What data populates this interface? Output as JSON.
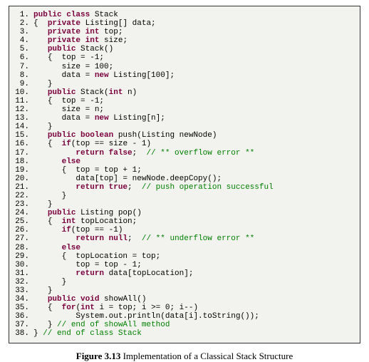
{
  "caption_bold": "Figure 3.13",
  "caption_rest": " Implementation of a Classical Stack Structure",
  "lines": [
    {
      "n": "1.",
      "indent": 0,
      "segs": [
        {
          "t": "public class",
          "c": "kw"
        },
        {
          "t": " Stack"
        }
      ]
    },
    {
      "n": "2.",
      "indent": 0,
      "segs": [
        {
          "t": "{  "
        },
        {
          "t": "private",
          "c": "kw"
        },
        {
          "t": " Listing[] data;"
        }
      ]
    },
    {
      "n": "3.",
      "indent": 1,
      "segs": [
        {
          "t": "private int",
          "c": "kw"
        },
        {
          "t": " top;"
        }
      ]
    },
    {
      "n": "4.",
      "indent": 1,
      "segs": [
        {
          "t": "private int",
          "c": "kw"
        },
        {
          "t": " size;"
        }
      ]
    },
    {
      "n": "5.",
      "indent": 1,
      "segs": [
        {
          "t": "public",
          "c": "kw"
        },
        {
          "t": " Stack()"
        }
      ]
    },
    {
      "n": "6.",
      "indent": 1,
      "segs": [
        {
          "t": "{  top = -1;"
        }
      ]
    },
    {
      "n": "7.",
      "indent": 2,
      "segs": [
        {
          "t": "size = 100;"
        }
      ]
    },
    {
      "n": "8.",
      "indent": 2,
      "segs": [
        {
          "t": "data = "
        },
        {
          "t": "new",
          "c": "kw"
        },
        {
          "t": " Listing[100];"
        }
      ]
    },
    {
      "n": "9.",
      "indent": 1,
      "segs": [
        {
          "t": "}"
        }
      ]
    },
    {
      "n": "10.",
      "indent": 1,
      "segs": [
        {
          "t": "public",
          "c": "kw"
        },
        {
          "t": " Stack("
        },
        {
          "t": "int",
          "c": "kw"
        },
        {
          "t": " n)"
        }
      ]
    },
    {
      "n": "11.",
      "indent": 1,
      "segs": [
        {
          "t": "{  top = -1;"
        }
      ]
    },
    {
      "n": "12.",
      "indent": 2,
      "segs": [
        {
          "t": "size = n;"
        }
      ]
    },
    {
      "n": "13.",
      "indent": 2,
      "segs": [
        {
          "t": "data = "
        },
        {
          "t": "new",
          "c": "kw"
        },
        {
          "t": " Listing[n];"
        }
      ]
    },
    {
      "n": "14.",
      "indent": 1,
      "segs": [
        {
          "t": "}"
        }
      ]
    },
    {
      "n": "15.",
      "indent": 1,
      "segs": [
        {
          "t": "public boolean",
          "c": "kw"
        },
        {
          "t": " push(Listing newNode)"
        }
      ]
    },
    {
      "n": "16.",
      "indent": 1,
      "segs": [
        {
          "t": "{  "
        },
        {
          "t": "if",
          "c": "kw"
        },
        {
          "t": "(top == size - 1)"
        }
      ]
    },
    {
      "n": "17.",
      "indent": 3,
      "segs": [
        {
          "t": "return false",
          "c": "kw"
        },
        {
          "t": ";  "
        },
        {
          "t": "// ** overflow error **",
          "c": "cm"
        }
      ]
    },
    {
      "n": "18.",
      "indent": 2,
      "segs": [
        {
          "t": "else",
          "c": "kw"
        }
      ]
    },
    {
      "n": "19.",
      "indent": 2,
      "segs": [
        {
          "t": "{  top = top + 1;"
        }
      ]
    },
    {
      "n": "20.",
      "indent": 3,
      "segs": [
        {
          "t": "data[top] = newNode.deepCopy();"
        }
      ]
    },
    {
      "n": "21.",
      "indent": 3,
      "segs": [
        {
          "t": "return true",
          "c": "kw"
        },
        {
          "t": ";  "
        },
        {
          "t": "// push operation successful",
          "c": "cm"
        }
      ]
    },
    {
      "n": "22.",
      "indent": 2,
      "segs": [
        {
          "t": "}"
        }
      ]
    },
    {
      "n": "23.",
      "indent": 1,
      "segs": [
        {
          "t": "}"
        }
      ]
    },
    {
      "n": "24.",
      "indent": 1,
      "segs": [
        {
          "t": "public",
          "c": "kw"
        },
        {
          "t": " Listing pop()"
        }
      ]
    },
    {
      "n": "25.",
      "indent": 1,
      "segs": [
        {
          "t": "{  "
        },
        {
          "t": "int",
          "c": "kw"
        },
        {
          "t": " topLocation;"
        }
      ]
    },
    {
      "n": "26.",
      "indent": 2,
      "segs": [
        {
          "t": "if",
          "c": "kw"
        },
        {
          "t": "(top == -1)"
        }
      ]
    },
    {
      "n": "27.",
      "indent": 3,
      "segs": [
        {
          "t": "return null",
          "c": "kw"
        },
        {
          "t": ";  "
        },
        {
          "t": "// ** underflow error **",
          "c": "cm"
        }
      ]
    },
    {
      "n": "28.",
      "indent": 2,
      "segs": [
        {
          "t": "else",
          "c": "kw"
        }
      ]
    },
    {
      "n": "29.",
      "indent": 2,
      "segs": [
        {
          "t": "{  topLocation = top;"
        }
      ]
    },
    {
      "n": "30.",
      "indent": 3,
      "segs": [
        {
          "t": "top = top - 1;"
        }
      ]
    },
    {
      "n": "31.",
      "indent": 3,
      "segs": [
        {
          "t": "return",
          "c": "kw"
        },
        {
          "t": " data[topLocation];"
        }
      ]
    },
    {
      "n": "32.",
      "indent": 2,
      "segs": [
        {
          "t": "}"
        }
      ]
    },
    {
      "n": "33.",
      "indent": 1,
      "segs": [
        {
          "t": "}"
        }
      ]
    },
    {
      "n": "34.",
      "indent": 1,
      "segs": [
        {
          "t": "public void",
          "c": "kw"
        },
        {
          "t": " showAll()"
        }
      ]
    },
    {
      "n": "35.",
      "indent": 1,
      "segs": [
        {
          "t": "{  "
        },
        {
          "t": "for",
          "c": "kw"
        },
        {
          "t": "("
        },
        {
          "t": "int",
          "c": "kw"
        },
        {
          "t": " i = top; i >= 0; i--)"
        }
      ]
    },
    {
      "n": "36.",
      "indent": 3,
      "segs": [
        {
          "t": "System.out.println(data[i].toString());"
        }
      ]
    },
    {
      "n": "37.",
      "indent": 1,
      "segs": [
        {
          "t": "} "
        },
        {
          "t": "// end of showAll method",
          "c": "cm"
        }
      ]
    },
    {
      "n": "38.",
      "indent": 0,
      "segs": [
        {
          "t": "} "
        },
        {
          "t": "// end of class Stack",
          "c": "cm"
        }
      ]
    }
  ]
}
